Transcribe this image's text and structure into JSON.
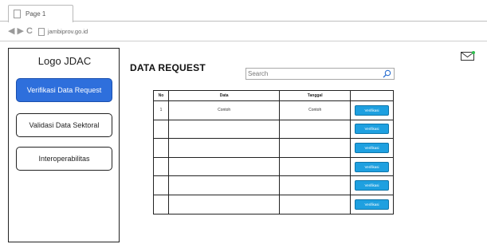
{
  "browser": {
    "tab_title": "Page 1",
    "url": "jambiprov.go.id"
  },
  "sidebar": {
    "logo": "Logo JDAC",
    "items": [
      {
        "label": "Verifikasi Data Request",
        "active": true
      },
      {
        "label": "Validasi Data Sektoral",
        "active": false
      },
      {
        "label": "Interoperabilitas",
        "active": false
      }
    ]
  },
  "main": {
    "title": "DATA REQUEST",
    "search": {
      "placeholder": "Search",
      "value": ""
    },
    "table": {
      "headers": [
        "No",
        "Data",
        "Tanggal",
        ""
      ],
      "action_label": "Verifikasi",
      "rows": [
        {
          "no": "1",
          "data": "Contoh",
          "tanggal": "Contoh"
        },
        {
          "no": "",
          "data": "",
          "tanggal": ""
        },
        {
          "no": "",
          "data": "",
          "tanggal": ""
        },
        {
          "no": "",
          "data": "",
          "tanggal": ""
        },
        {
          "no": "",
          "data": "",
          "tanggal": ""
        },
        {
          "no": "",
          "data": "",
          "tanggal": ""
        }
      ]
    }
  },
  "colors": {
    "active_nav": "#2e6fdc",
    "verify_button": "#1ea0e0",
    "mail_badge": "#2fbf4f"
  },
  "icons": [
    "page-icon",
    "back-arrow-icon",
    "forward-arrow-icon",
    "refresh-icon",
    "search-icon",
    "mail-icon"
  ]
}
